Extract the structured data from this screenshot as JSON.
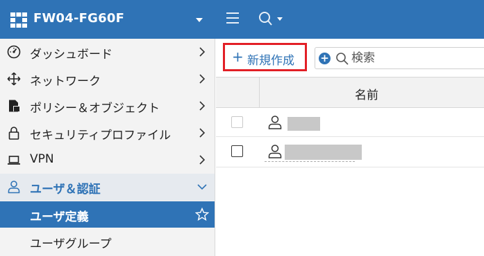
{
  "header": {
    "device_name": "FW04-FG60F",
    "colors": {
      "bar": "#2f73b6",
      "active": "#2f73b6",
      "highlight": "#e21f26"
    },
    "icons": [
      "fortinet-logo-icon",
      "chevron-down-icon",
      "hamburger-menu-icon",
      "search-icon"
    ]
  },
  "sidebar": {
    "items": [
      {
        "label": "ダッシュボード",
        "icon": "dashboard-icon"
      },
      {
        "label": "ネットワーク",
        "icon": "network-icon"
      },
      {
        "label": "ポリシー＆オブジェクト",
        "icon": "policy-icon"
      },
      {
        "label": "セキュリティプロファイル",
        "icon": "lock-icon"
      },
      {
        "label": "VPN",
        "icon": "laptop-icon"
      },
      {
        "label": "ユーザ＆認証",
        "icon": "user-icon",
        "expanded": true
      }
    ],
    "subitems": [
      {
        "label": "ユーザ定義",
        "active": true
      },
      {
        "label": "ユーザグループ",
        "active": false
      }
    ]
  },
  "toolbar": {
    "new_label": "新規作成",
    "search_placeholder": "検索"
  },
  "table": {
    "columns": [
      "名前"
    ],
    "rows": [
      {
        "name": "",
        "redacted": true
      },
      {
        "name": "",
        "redacted": true
      }
    ]
  }
}
